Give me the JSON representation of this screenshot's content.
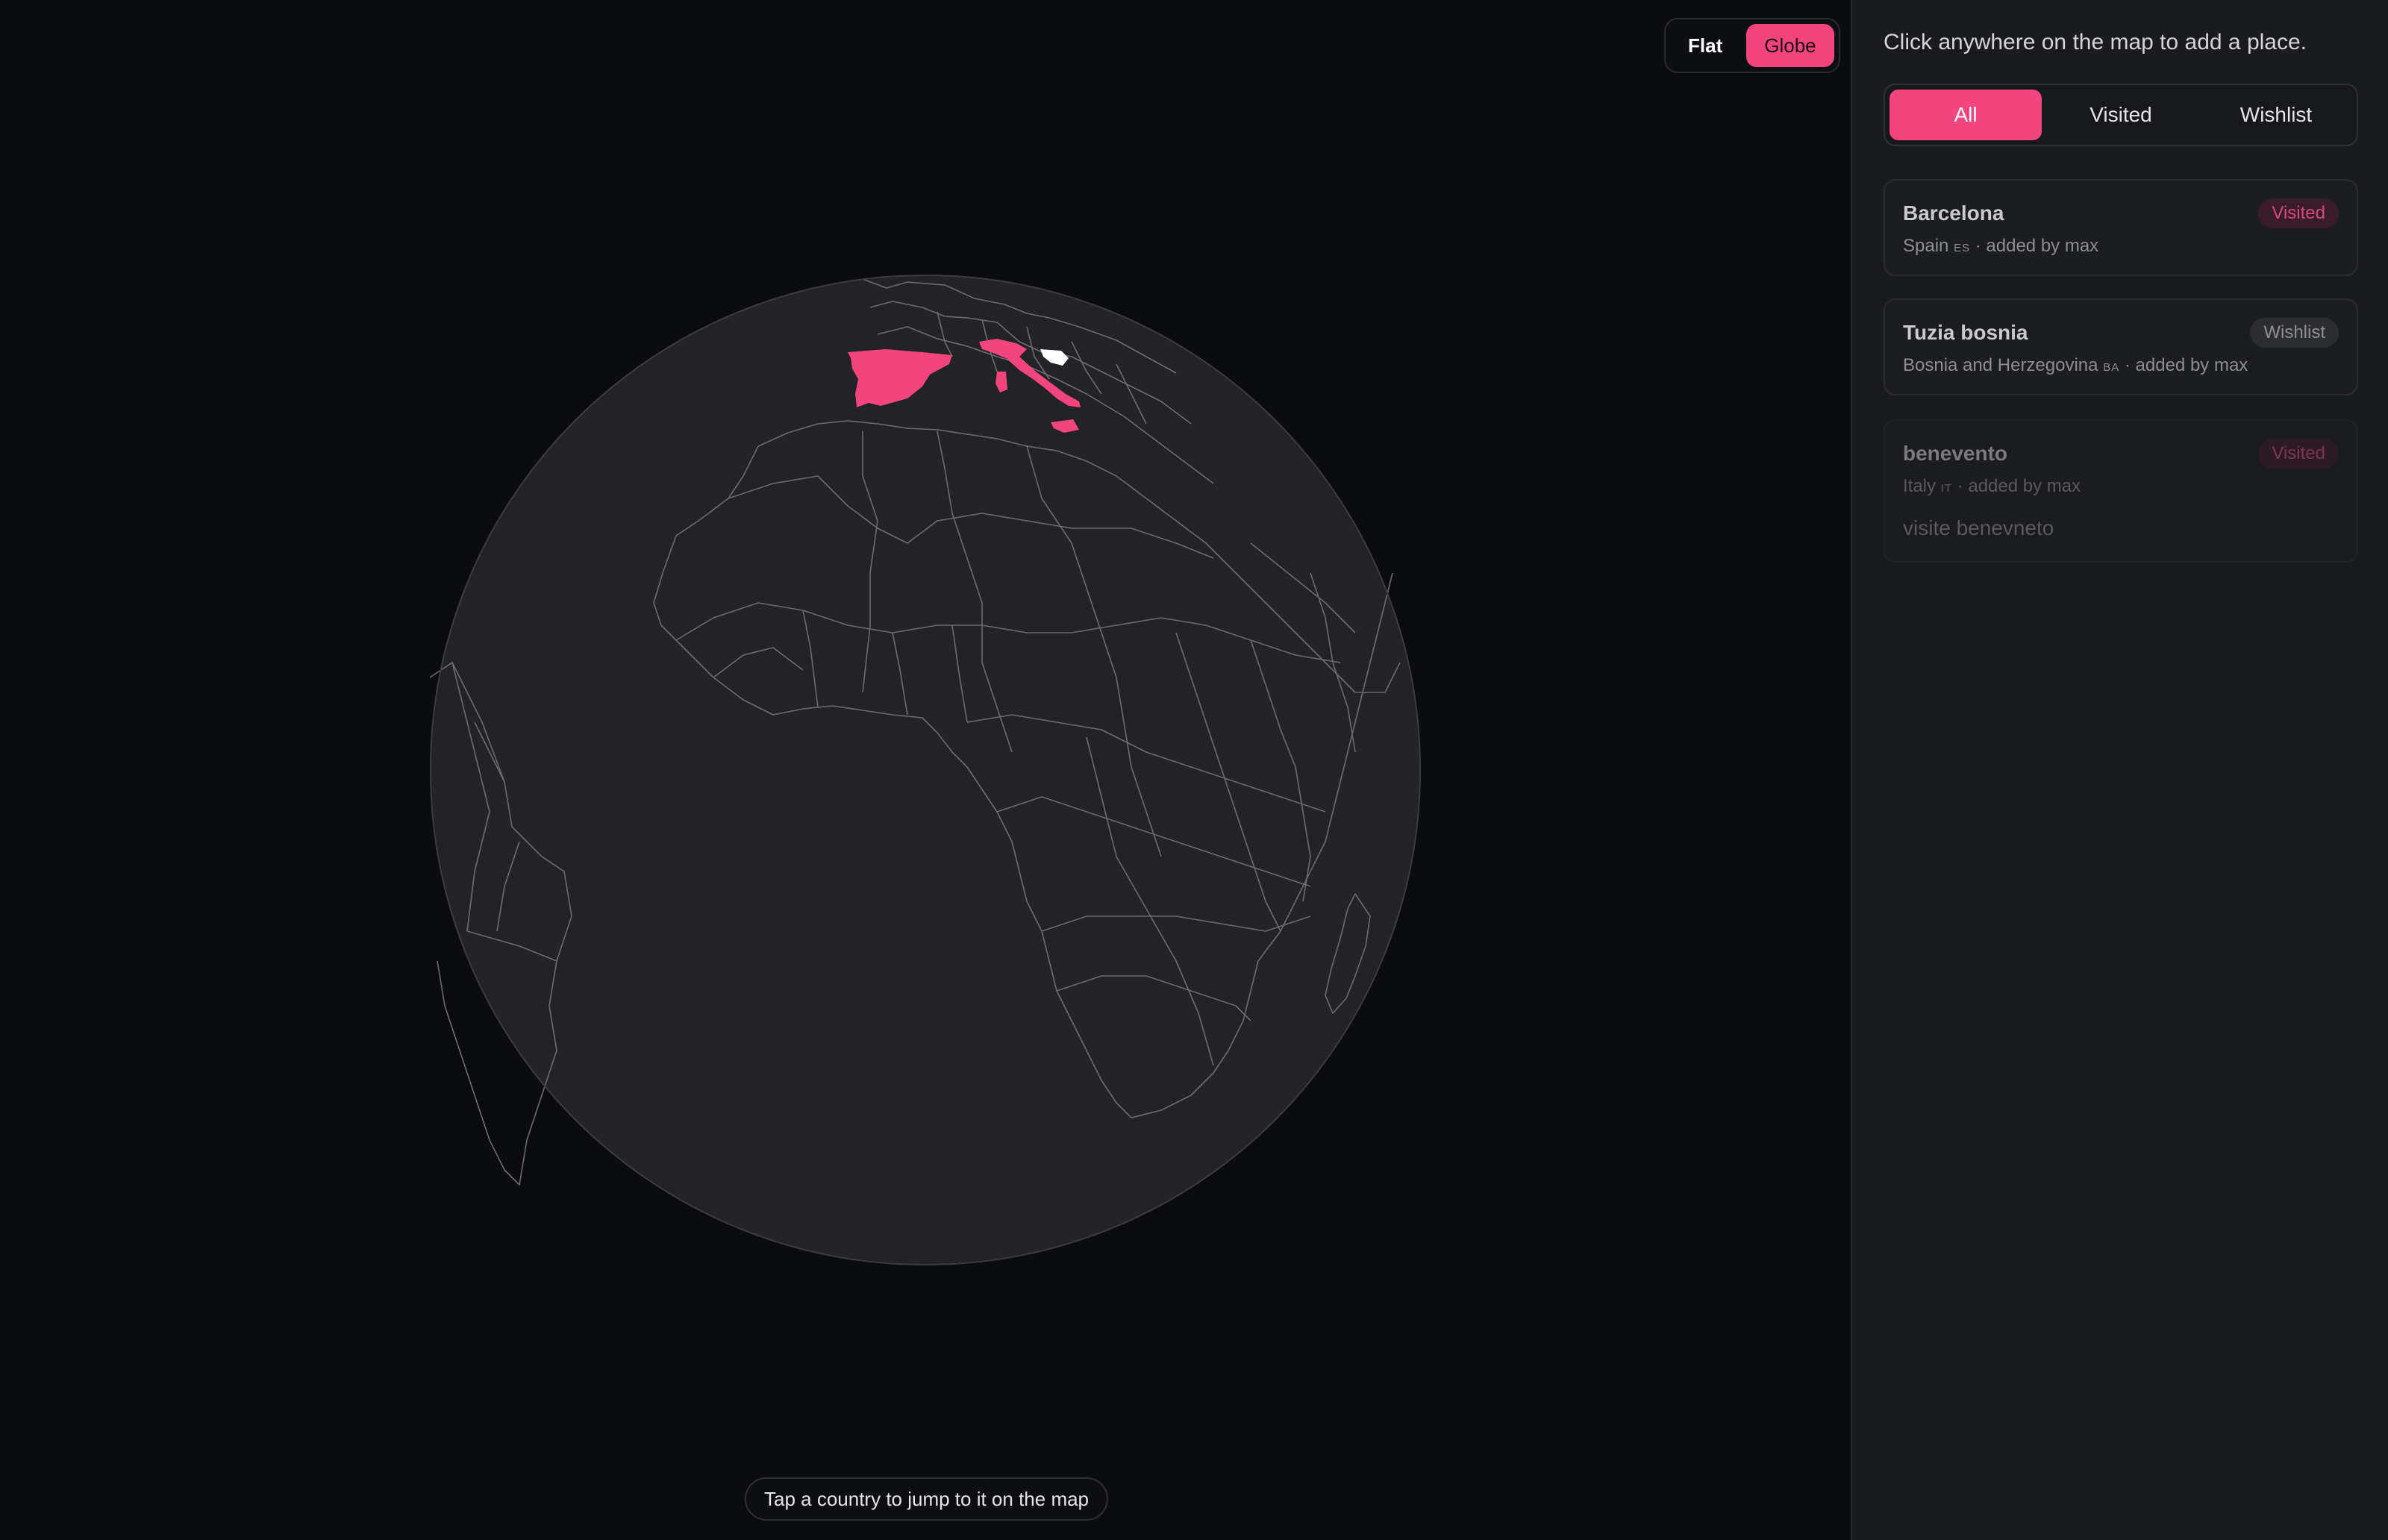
{
  "map": {
    "view_toggle": {
      "flat_label": "Flat",
      "globe_label": "Globe",
      "active": "Globe"
    },
    "hint": "Tap a country to jump to it on the map",
    "highlighted_countries": [
      "Spain",
      "Italy",
      "Bosnia and Herzegovina"
    ],
    "colors": {
      "visited": "#f2457d",
      "wishlist": "#ffffff",
      "land": "#232327",
      "glow": "#c8173c"
    }
  },
  "sidebar": {
    "hint": "Click anywhere on the map to add a place.",
    "filters": [
      {
        "label": "All",
        "active": true
      },
      {
        "label": "Visited",
        "active": false
      },
      {
        "label": "Wishlist",
        "active": false
      }
    ],
    "places": [
      {
        "name": "Barcelona",
        "country": "Spain",
        "code": "ES",
        "added_by": "· added by max",
        "status": "Visited",
        "note": ""
      },
      {
        "name": "Tuzia bosnia",
        "country": "Bosnia and Herzegovina",
        "code": "BA",
        "added_by": "· added by max",
        "status": "Wishlist",
        "note": ""
      },
      {
        "name": "benevento",
        "country": "Italy",
        "code": "IT",
        "added_by": "· added by max",
        "status": "Visited",
        "note": "visite benevneto"
      }
    ]
  }
}
